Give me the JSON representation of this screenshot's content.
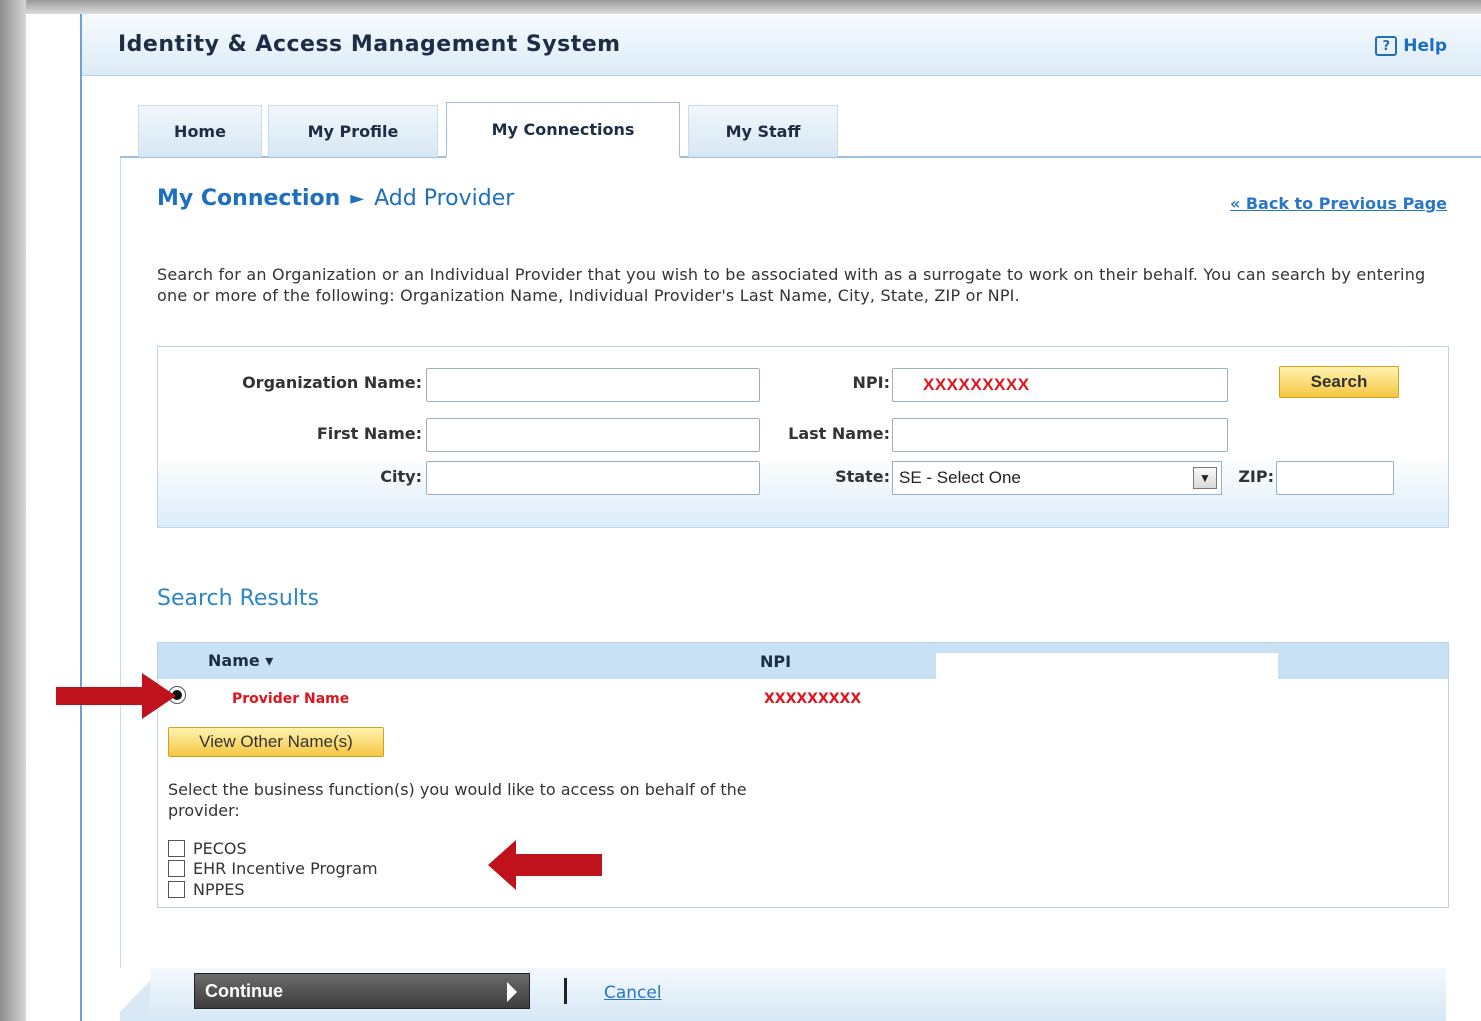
{
  "header": {
    "title": "Identity & Access Management System",
    "help_label": "Help",
    "help_icon_glyph": "?"
  },
  "tabs": [
    {
      "label": "Home",
      "active": false
    },
    {
      "label": "My Profile",
      "active": false
    },
    {
      "label": "My Connections",
      "active": true
    },
    {
      "label": "My Staff",
      "active": false
    }
  ],
  "breadcrumb": {
    "parent": "My Connection",
    "separator": "►",
    "current": "Add Provider"
  },
  "back_link": "« Back to Previous Page",
  "instructions": "Search for an Organization or an Individual Provider that you wish to be associated with as a surrogate to work on their behalf. You can search by entering one or more of the following: Organization Name, Individual Provider's Last Name, City, State, ZIP or NPI.",
  "search_form": {
    "org_name_label": "Organization Name:",
    "org_name_value": "",
    "npi_label": "NPI:",
    "npi_value": "XXXXXXXXX",
    "first_name_label": "First Name:",
    "first_name_value": "",
    "last_name_label": "Last Name:",
    "last_name_value": "",
    "city_label": "City:",
    "city_value": "",
    "state_label": "State:",
    "state_selected": "SE - Select One",
    "zip_label": "ZIP:",
    "zip_value": "",
    "search_button": "Search"
  },
  "results": {
    "title": "Search Results",
    "columns": {
      "name": "Name ▾",
      "npi": "NPI"
    },
    "rows": [
      {
        "name": "Provider Name",
        "npi": "XXXXXXXXX",
        "selected": true
      }
    ],
    "view_other_names_button": "View Other Name(s)",
    "business_functions_prompt": "Select the business function(s) you would like to access on behalf of the provider:",
    "business_functions": [
      {
        "label": "PECOS",
        "checked": false
      },
      {
        "label": "EHR Incentive Program",
        "checked": false
      },
      {
        "label": "NPPES",
        "checked": false
      }
    ]
  },
  "footer": {
    "continue_button": "Continue",
    "cancel_link": "Cancel"
  },
  "colors": {
    "accent_blue": "#1f6fbf",
    "highlight_red": "#e0141c",
    "annotation_arrow": "#c0121c",
    "search_button_yellow": "#f6c743"
  }
}
